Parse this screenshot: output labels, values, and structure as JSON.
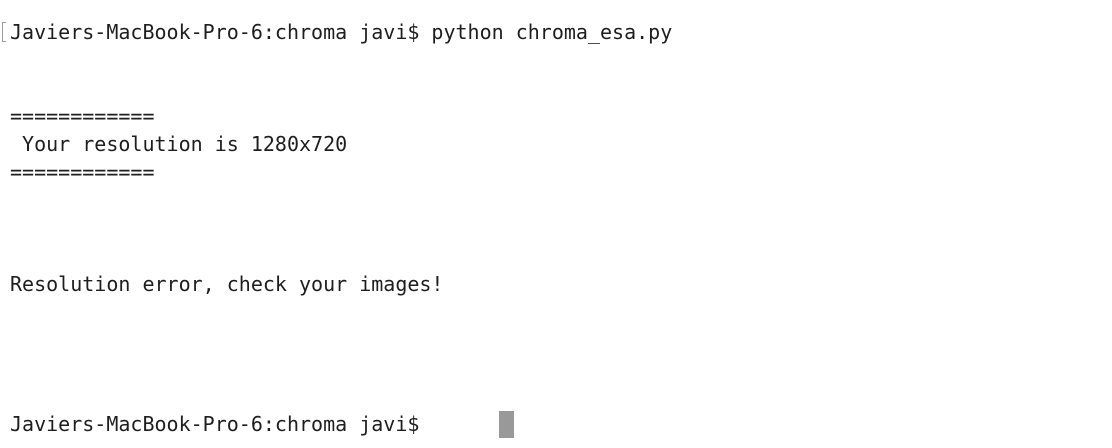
{
  "terminal": {
    "command_prompt": "Javiers-MacBook-Pro-6:chroma javi$ python chroma_esa.py",
    "separator_top": "============",
    "resolution_message": " Your resolution is 1280x720",
    "separator_bottom": "============",
    "error_message": "Resolution error, check your images!",
    "current_prompt": "Javiers-MacBook-Pro-6:chroma javi$"
  }
}
